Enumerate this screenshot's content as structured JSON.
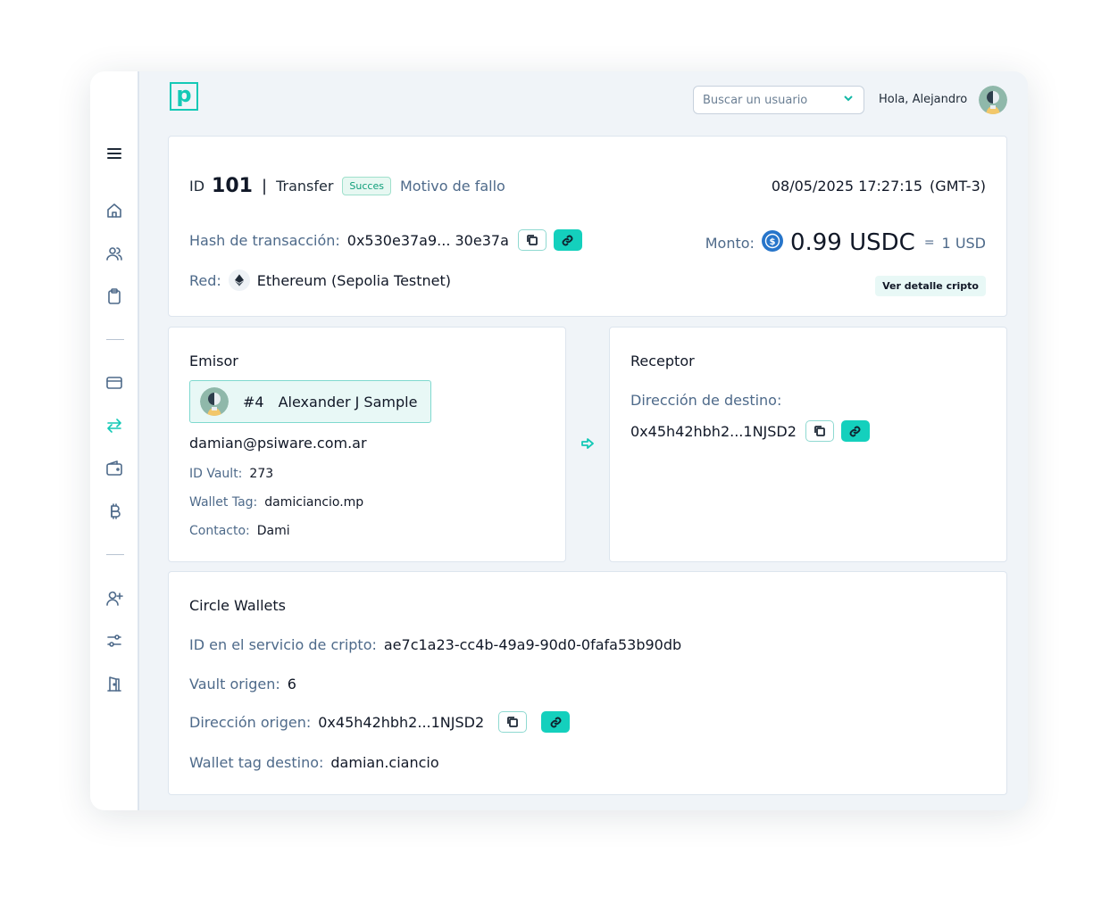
{
  "header": {
    "logo": "p",
    "search_placeholder": "Buscar un usuario",
    "greeting": "Hola, Alejandro"
  },
  "summary": {
    "id_label": "ID",
    "id_value": "101",
    "separator": "|",
    "type": "Transfer",
    "status_badge": "Succes",
    "failure_reason": "Motivo de fallo",
    "datetime": "08/05/2025 17:27:15",
    "timezone": "(GMT-3)",
    "hash_label": "Hash de transacción:",
    "hash_value": "0x530e37a9... 30e37a",
    "network_label": "Red:",
    "network_value": "Ethereum (Sepolia Testnet)",
    "amount_label": "Monto:",
    "amount_value": "0.99 USDC",
    "amount_equals": "=",
    "amount_fiat": "1 USD",
    "detail_button": "Ver detalle cripto"
  },
  "sender": {
    "title": "Emisor",
    "number": "#4",
    "name": "Alexander J Sample",
    "email": "damian@psiware.com.ar",
    "vault_label": "ID Vault:",
    "vault_value": "273",
    "wallet_tag_label": "Wallet Tag:",
    "wallet_tag_value": "damiciancio.mp",
    "contact_label": "Contacto:",
    "contact_value": "Dami"
  },
  "receiver": {
    "title": "Receptor",
    "address_label": "Dirección de destino:",
    "address_value": "0x45h42hbh2...1NJSD2"
  },
  "circle": {
    "title": "Circle Wallets",
    "service_id_label": "ID en el servicio de cripto:",
    "service_id_value": "ae7c1a23-cc4b-49a9-90d0-0fafa53b90db",
    "vault_origin_label": "Vault origen:",
    "vault_origin_value": "6",
    "origin_address_label": "Dirección origen:",
    "origin_address_value": "0x45h42hbh2...1NJSD2",
    "dest_tag_label": "Wallet tag destino:",
    "dest_tag_value": "damian.ciancio"
  },
  "icons": {
    "sidebar": [
      "menu-icon",
      "home-icon",
      "users-icon",
      "clipboard-icon",
      "credit-card-icon",
      "transfer-arrows-icon",
      "wallet-icon",
      "bitcoin-icon",
      "add-user-icon",
      "settings-sliders-icon",
      "exit-door-icon"
    ],
    "active": "transfer-arrows-icon"
  },
  "colors": {
    "accent": "#14d0bd",
    "background": "#f0f4f8",
    "label": "#4e6a8a",
    "usdc": "#2775ca"
  }
}
